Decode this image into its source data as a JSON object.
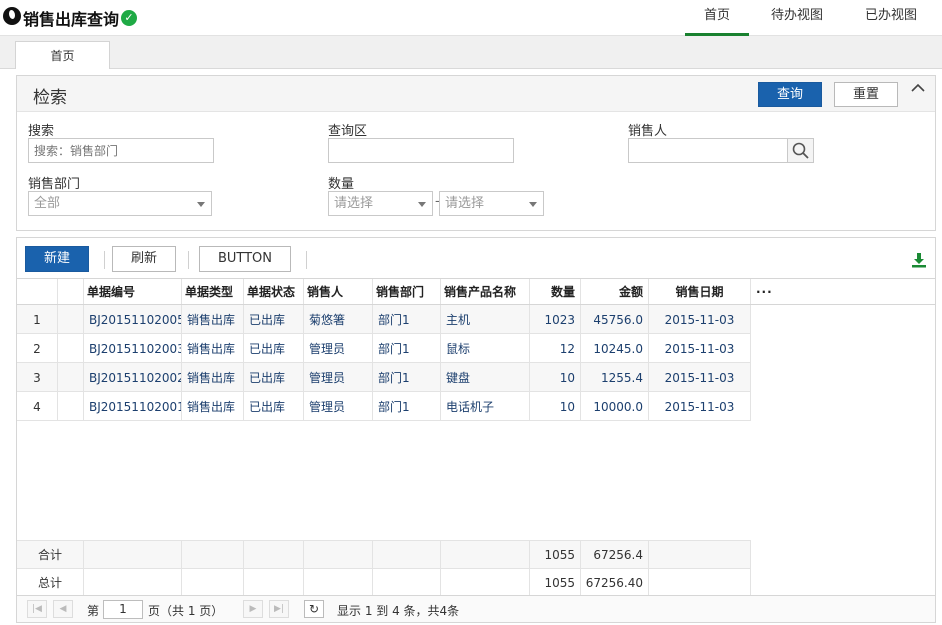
{
  "app": {
    "title": "销售出库查询"
  },
  "nav": {
    "home": "首页",
    "todo": "待办视图",
    "done": "已办视图"
  },
  "tabs": [
    {
      "label": "首页"
    }
  ],
  "search": {
    "title": "检索",
    "query_label": "查询",
    "reset_label": "重置",
    "fields": {
      "search": {
        "label": "搜索",
        "placeholder": "搜索：销售部门"
      },
      "query_area": {
        "label": "查询区",
        "value": ""
      },
      "salesperson": {
        "label": "销售人",
        "value": ""
      },
      "dept": {
        "label": "销售部门",
        "value": "全部"
      },
      "qty": {
        "label": "数量",
        "from": "请选择",
        "to": "请选择",
        "sep": "-"
      }
    }
  },
  "toolbar": {
    "new": "新建",
    "refresh": "刷新",
    "button": "BUTTON"
  },
  "table": {
    "columns": [
      "单据编号",
      "单据类型",
      "单据状态",
      "销售人",
      "销售部门",
      "销售产品名称",
      "数量",
      "金额",
      "销售日期",
      "···"
    ],
    "rows": [
      {
        "idx": "1",
        "code": "BJ20151102005",
        "type": "销售出库",
        "status": "已出库",
        "person": "菊悠箸",
        "dept": "部门1",
        "product": "主机",
        "qty": "1023",
        "amount": "45756.0",
        "date": "2015-11-03"
      },
      {
        "idx": "2",
        "code": "BJ20151102003",
        "type": "销售出库",
        "status": "已出库",
        "person": "管理员",
        "dept": "部门1",
        "product": "鼠标",
        "qty": "12",
        "amount": "10245.0",
        "date": "2015-11-03"
      },
      {
        "idx": "3",
        "code": "BJ20151102002",
        "type": "销售出库",
        "status": "已出库",
        "person": "管理员",
        "dept": "部门1",
        "product": "键盘",
        "qty": "10",
        "amount": "1255.4",
        "date": "2015-11-03"
      },
      {
        "idx": "4",
        "code": "BJ20151102001",
        "type": "销售出库",
        "status": "已出库",
        "person": "管理员",
        "dept": "部门1",
        "product": "电话机子",
        "qty": "10",
        "amount": "10000.0",
        "date": "2015-11-03"
      }
    ],
    "subtotal": {
      "label": "合计",
      "qty": "1055",
      "amount": "67256.4"
    },
    "total": {
      "label": "总计",
      "qty": "1055",
      "amount": "67256.40"
    }
  },
  "pager": {
    "page_prefix": "第",
    "page": "1",
    "page_suffix": "页（共 1 页）",
    "info": "显示 1 到 4 条，共4条"
  },
  "colors": {
    "primary": "#1a62ad",
    "nav_active": "#19812f",
    "check": "#1faa45",
    "cell_text": "#1c3f6e",
    "download": "#1a8a34"
  }
}
